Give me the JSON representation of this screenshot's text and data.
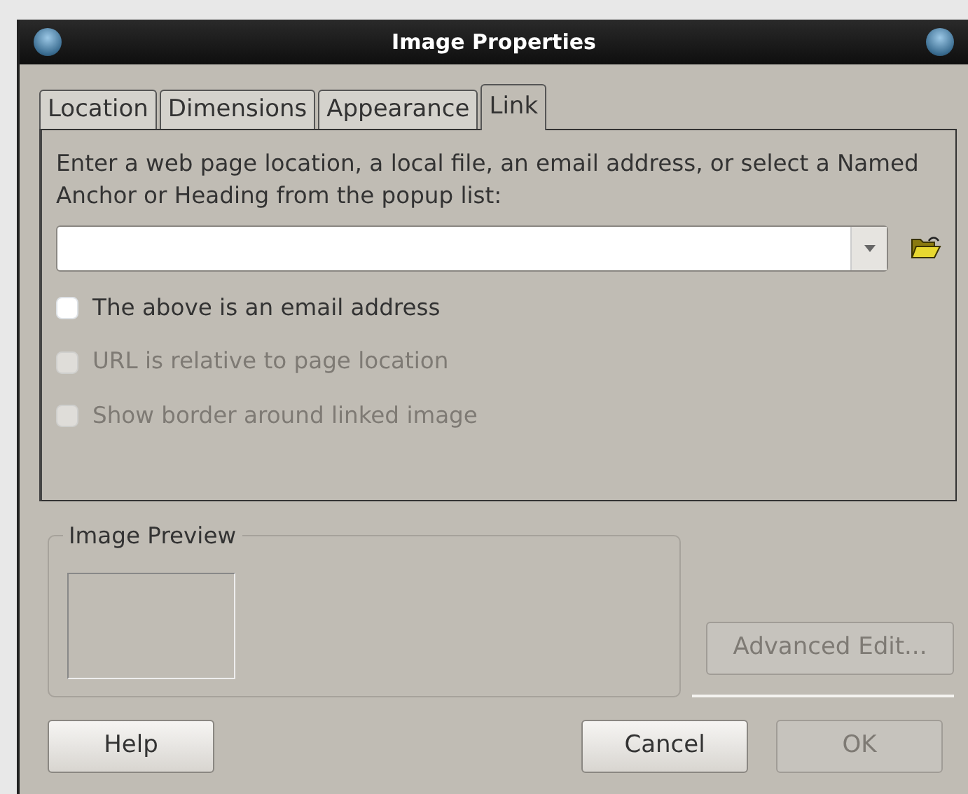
{
  "window": {
    "title": "Image Properties"
  },
  "tabs": [
    {
      "label": "Location",
      "selected": false
    },
    {
      "label": "Dimensions",
      "selected": false
    },
    {
      "label": "Appearance",
      "selected": false
    },
    {
      "label": "Link",
      "selected": true
    }
  ],
  "link": {
    "instructions": "Enter a web page location, a local file, an email address, or select a Named Anchor or Heading from the popup list:",
    "checkboxes": [
      {
        "label": "The above is an email address",
        "checked": false,
        "disabled": false
      },
      {
        "label": "URL is relative to page location",
        "checked": false,
        "disabled": true
      },
      {
        "label": "Show border around linked image",
        "checked": false,
        "disabled": true
      }
    ]
  },
  "preview": {
    "title": "Image Preview"
  },
  "advanced_edit": {
    "label": "Advanced Edit...",
    "disabled": true
  },
  "buttons": [
    {
      "label": "Help",
      "kind": "help",
      "disabled": false
    },
    {
      "label": "Cancel",
      "kind": "action",
      "disabled": false
    },
    {
      "label": "OK",
      "kind": "action",
      "disabled": true
    }
  ]
}
